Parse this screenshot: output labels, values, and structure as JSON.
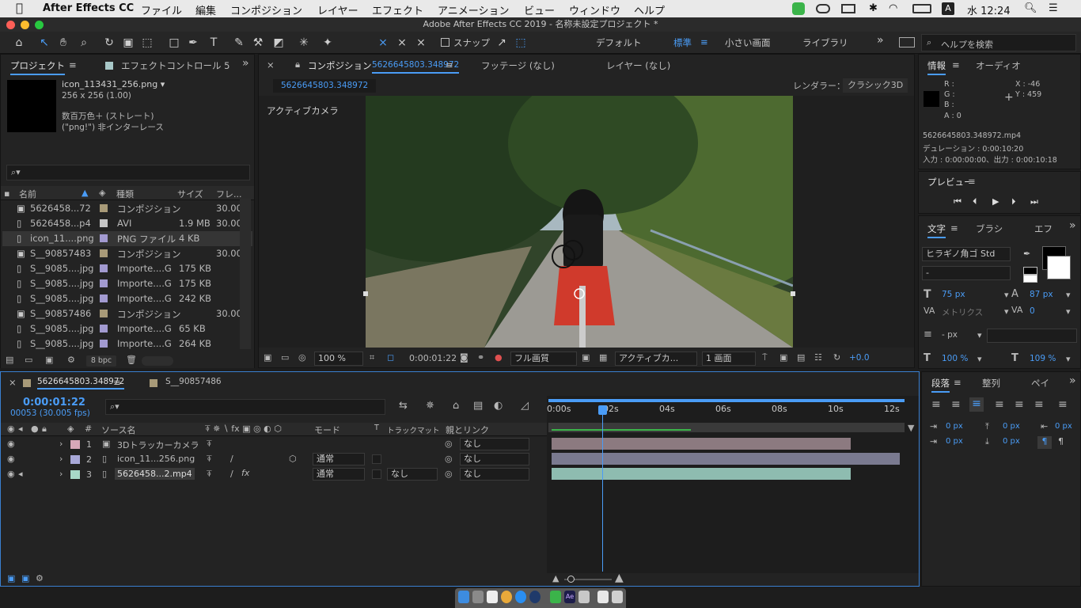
{
  "menubar": {
    "apple": "",
    "app": "After Effects CC",
    "items": [
      "ファイル",
      "編集",
      "コンポジション",
      "レイヤー",
      "エフェクト",
      "アニメーション",
      "ビュー",
      "ウィンドウ",
      "ヘルプ"
    ],
    "clock": "水 12:24",
    "ime": "A"
  },
  "window": {
    "title": "Adobe After Effects CC 2019 - 名称未設定プロジェクト *"
  },
  "toolbar": {
    "snap": "スナップ",
    "workspaces": [
      "デフォルト",
      "標準",
      "小さい画面",
      "ライブラリ"
    ],
    "active_workspace": "標準",
    "search_placeholder": "ヘルプを検索"
  },
  "project": {
    "tab": "プロジェクト",
    "tab2": "エフェクトコントロール 5",
    "file_name": "icon_113431_256.png ▾",
    "file_dims": "256 x 256 (1.00)",
    "file_color": "数百万色＋ (ストレート)",
    "file_interlace": "(\"png!\") 非インターレース",
    "search_placeholder": "",
    "columns": {
      "name": "名前",
      "type": "種類",
      "size": "サイズ",
      "fr": "フレ..."
    },
    "items": [
      {
        "name": "5626458...72",
        "type": "コンポジション",
        "size": "",
        "fr": "30.00",
        "swatch": "#a89a78"
      },
      {
        "name": "5626458...p4",
        "type": "AVI",
        "size": "1.9 MB",
        "fr": "30.00",
        "swatch": "#c6c6c6"
      },
      {
        "name": "icon_11....png",
        "type": "PNG ファイル",
        "size": "4 KB",
        "fr": "",
        "swatch": "#a29ad0"
      },
      {
        "name": "S__90857483",
        "type": "コンポジション",
        "size": "",
        "fr": "30.00",
        "swatch": "#a89a78"
      },
      {
        "name": "S__9085....jpg",
        "type": "Importe....G",
        "size": "175 KB",
        "fr": "",
        "swatch": "#a29ad0"
      },
      {
        "name": "S__9085....jpg",
        "type": "Importe....G",
        "size": "175 KB",
        "fr": "",
        "swatch": "#a29ad0"
      },
      {
        "name": "S__9085....jpg",
        "type": "Importe....G",
        "size": "242 KB",
        "fr": "",
        "swatch": "#a29ad0"
      },
      {
        "name": "S__90857486",
        "type": "コンポジション",
        "size": "",
        "fr": "30.00",
        "swatch": "#a89a78"
      },
      {
        "name": "S__9085....jpg",
        "type": "Importe....G",
        "size": "65 KB",
        "fr": "",
        "swatch": "#a29ad0"
      },
      {
        "name": "S__9085....jpg",
        "type": "Importe....G",
        "size": "264 KB",
        "fr": "",
        "swatch": "#a29ad0"
      }
    ],
    "bpc": "8 bpc"
  },
  "viewer": {
    "tab": "コンポジション",
    "comp_name": "5626645803.348972",
    "footage_tab": "フッテージ (なし)",
    "layer_tab": "レイヤー (なし)",
    "sub_tab": "5626645803.348972",
    "renderer_label": "レンダラー：",
    "renderer": "クラシック3D",
    "camera_label": "アクティブカメラ",
    "zoom": "100 %",
    "timecode": "0:00:01:22",
    "quality": "フル画質",
    "view": "アクティブカ...",
    "views": "1 画面",
    "exposure": "+0.0"
  },
  "info": {
    "tab": "情報",
    "tab2": "オーディオ",
    "r": "R :",
    "g": "G :",
    "b": "B :",
    "a": "A : 0",
    "x": "X : -46",
    "y": "Y : 459",
    "file": "5626645803.348972.mp4",
    "duration": "デュレーション : 0:00:10:20",
    "inout": "入力 : 0:00:00:00、出力 : 0:00:10:18"
  },
  "preview": {
    "tab": "プレビュー"
  },
  "character": {
    "tab": "文字",
    "tab2": "ブラシ",
    "tab3": "エフ",
    "font": "ヒラギノ角ゴ Std",
    "style": "-",
    "size": "75 px",
    "leading": "87 px",
    "kerning": "メトリクス",
    "tracking": "0",
    "stroke": "- px",
    "vscale": "100 %",
    "hscale": "109 %"
  },
  "paragraph": {
    "tab": "段落",
    "tab2": "整列",
    "tab3": "ペイ",
    "v1": "0 px",
    "v2": "0 px",
    "v3": "0 px",
    "v4": "0 px",
    "v5": "0 px"
  },
  "timeline": {
    "tab": "5626645803.348972",
    "tab2": "S__90857486",
    "timecode": "0:00:01:22",
    "frames": "00053 (30.005 fps)",
    "search_placeholder": "",
    "cols": {
      "source": "ソース名",
      "mode": "モード",
      "t": "T",
      "trkmat": "トラックマット",
      "parent": "親とリンク"
    },
    "ruler": [
      "0:00s",
      "02s",
      "04s",
      "06s",
      "08s",
      "10s",
      "12s"
    ],
    "layers": [
      {
        "num": "1",
        "name": "3Dトラッカーカメラ",
        "mode": "",
        "trkmat": "",
        "parent": "なし",
        "color": "#d8a8b8"
      },
      {
        "num": "2",
        "name": "icon_11...256.png",
        "mode": "通常",
        "trkmat": "",
        "parent": "なし",
        "color": "#a8a8d8"
      },
      {
        "num": "3",
        "name": "5626458...2.mp4",
        "mode": "通常",
        "trkmat": "なし",
        "parent": "なし",
        "color": "#a8d8c8"
      }
    ]
  }
}
